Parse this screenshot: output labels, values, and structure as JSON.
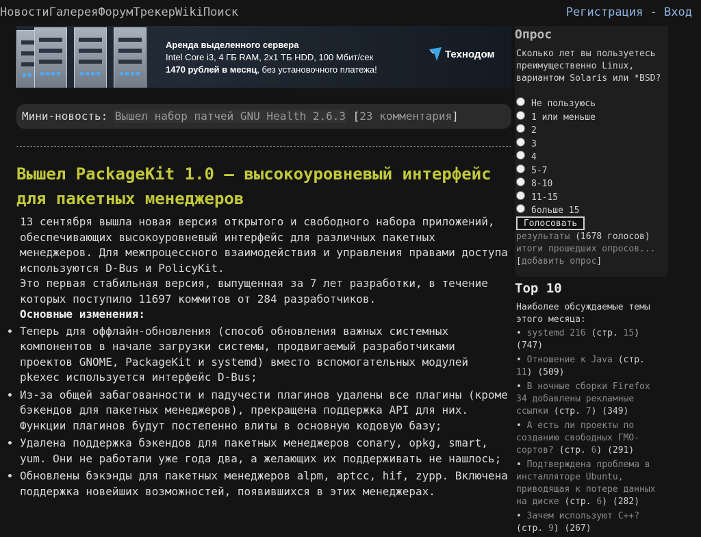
{
  "nav": {
    "items": [
      "Новости",
      "Галерея",
      "Форум",
      "Трекер",
      "Wiki",
      "Поиск"
    ],
    "register": "Регистрация",
    "sep": " - ",
    "login": "Вход"
  },
  "banner": {
    "title": "Аренда выделенного сервера",
    "spec": "Intel Core i3, 4 ГБ RAM, 2x1 ТБ HDD, 100 Мбит/сек",
    "price_bold": "1470 рублей в месяц",
    "price_rest": ", без установочного платежа!",
    "brand": "Технодом"
  },
  "mini": {
    "label": "Мини-новость:",
    "item": "Вышел набор патчей GNU Health 2.6.3",
    "comments": "23 комментария"
  },
  "article": {
    "title": "Вышел PackageKit 1.0 — высокоуровневый интерфейс для пакетных менеджеров",
    "p1": "13 сентября вышла новая версия открытого и свободного набора приложений, обеспечивающих высокоуровневый интерфейс для различных пакетных менеджеров. Для межпроцессного взаимодействия и управления правами доступа используются D-Bus и PolicyKit.",
    "p2": "Это первая стабильная версия, выпущенная за 7 лет разработки, в течение которых поступило 11697 коммитов от 284 разработчиков.",
    "changes_heading": "Основные изменения:",
    "changes": [
      "Теперь для оффлайн-обновления (способ обновления важных системных компонентов в начале загрузки системы, продвигаемый разработчиками проектов GNOME, PackageKit и systemd) вместо вспомогательных модулей pkexec используется интерфейс D-Bus;",
      "Из-за общей забагованности и падучести плагинов удалены все плагины (кроме бэкендов для пакетных менеджеров), прекращена поддержка API для них. Функции плагинов будут постепенно влиты в основную кодовую базу;",
      "Удалена поддержка бэкендов для пакетных менеджеров conary, opkg, smart, yum. Они не работали уже года два, а желающих их поддерживать не нашлось;",
      "Обновлены бэкэнды для пакетных менеджеров alpm, aptcc, hif, zypp. Включена поддержка новейших возможностей, появившихся в этих менеджерах."
    ]
  },
  "poll": {
    "heading": "Опрос",
    "question": "Сколько лет вы пользуетесь преимущественно Linux, вариантом Solaris или *BSD?",
    "options": [
      "Не пользуюсь",
      "1 или меньше",
      "2",
      "3",
      "4",
      "5-7",
      "8-10",
      "11-15",
      "больше 15"
    ],
    "vote": "Голосовать",
    "results": "результаты",
    "votes": " (1678 голосов)",
    "past": "итоги прошедших опросов...",
    "add": "добавить опрос"
  },
  "top10": {
    "heading": "Top 10",
    "subtitle": "Наиболее обсуждаемые темы этого месяца:",
    "items": [
      {
        "title": "systemd 216",
        "page": "15",
        "count": "(747)"
      },
      {
        "title": "Отношение к Java",
        "page": "11",
        "count": "(509)"
      },
      {
        "title": "В ночные сборки Firefox 34 добавлены рекламные ссылки",
        "page": "7",
        "count": "(349)"
      },
      {
        "title": "А есть ли проекты по созданию свободных ГМО-сортов?",
        "page": "6",
        "count": "(291)"
      },
      {
        "title": "Подтверждена проблема в инсталляторе Ubuntu, приводящая к потере данных на диске",
        "page": "6",
        "count": "(282)"
      },
      {
        "title": "Зачем используют C++?",
        "page": "9",
        "count": "(267)"
      }
    ]
  }
}
